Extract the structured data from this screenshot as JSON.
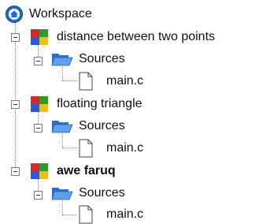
{
  "workspace": {
    "label": "Workspace",
    "icon": "workspace-globe-icon"
  },
  "projects": [
    {
      "name": "distance between two points",
      "bold": false,
      "folder": {
        "label": "Sources",
        "files": [
          {
            "name": "main.c"
          }
        ]
      }
    },
    {
      "name": "floating triangle",
      "bold": false,
      "folder": {
        "label": "Sources",
        "files": [
          {
            "name": "main.c"
          }
        ]
      }
    },
    {
      "name": "awe faruq",
      "bold": true,
      "folder": {
        "label": "Sources",
        "files": [
          {
            "name": "main.c"
          }
        ]
      }
    }
  ],
  "colors": {
    "project_icon": [
      "#d62a2a",
      "#2a9a2a",
      "#2a5ad6",
      "#e8c020"
    ],
    "folder": "#3d7fd6",
    "globe": "#1c6bd0"
  }
}
